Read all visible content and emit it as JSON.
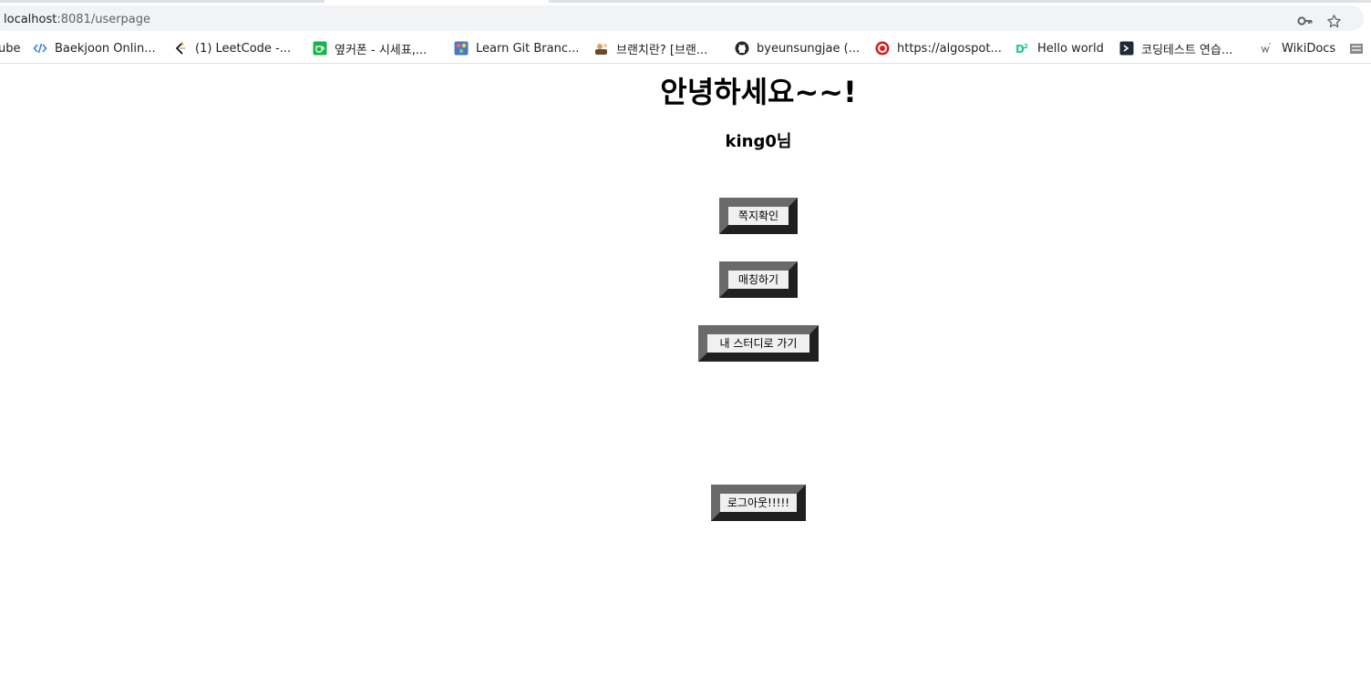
{
  "browser": {
    "url_host": "localhost",
    "url_path": ":8081/userpage",
    "bookmarks": [
      {
        "label": "ube",
        "icon": "youtube-icon"
      },
      {
        "label": "Baekjoon Onlin...",
        "icon": "baekjoon-icon"
      },
      {
        "label": "(1) LeetCode -...",
        "icon": "leetcode-icon"
      },
      {
        "label": "옆커폰 - 시세표,...",
        "icon": "coupon-icon"
      },
      {
        "label": "Learn Git Branc...",
        "icon": "git-icon"
      },
      {
        "label": "브랜치란? [브랜...",
        "icon": "branch-icon"
      },
      {
        "label": "byeunsungjae (...",
        "icon": "github-icon"
      },
      {
        "label": "https://algospot...",
        "icon": "algospot-icon"
      },
      {
        "label": "Hello world",
        "icon": "d2-icon"
      },
      {
        "label": "코딩테스트 연습...",
        "icon": "programmers-icon"
      },
      {
        "label": "WikiDocs",
        "icon": "wikidocs-icon"
      }
    ]
  },
  "page": {
    "greeting": "안녕하세요~~!",
    "username": "king0님",
    "buttons": {
      "messages": "쪽지확인",
      "matching": "매칭하기",
      "my_study": "내 스터디로 가기",
      "logout": "로그아웃!!!!!"
    }
  },
  "colors": {
    "bevel_light": "#6a6a6a",
    "bevel_dark": "#202020",
    "button_face": "#f0f0f0"
  }
}
